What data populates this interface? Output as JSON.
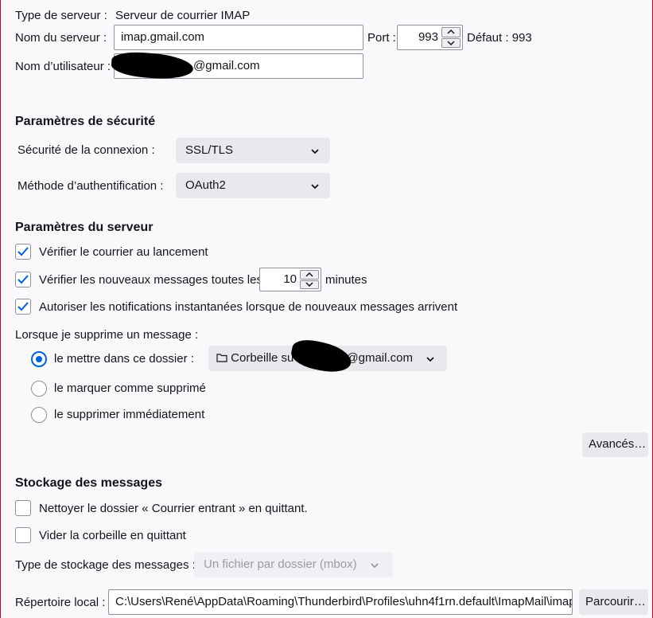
{
  "server": {
    "type_label": "Type de serveur :",
    "type_value": "Serveur de courrier IMAP",
    "name_label": "Nom du serveur :",
    "name_value": "imap.gmail.com",
    "port_label": "Port :",
    "port_value": "993",
    "default_label": "Défaut : 993",
    "user_label": "Nom d’utilisateur :",
    "user_value_suffix": "@gmail.com"
  },
  "security": {
    "heading": "Paramètres de sécurité",
    "connection_label": "Sécurité de la connexion :",
    "connection_value": "SSL/TLS",
    "auth_label": "Méthode d’authentification :",
    "auth_value": "OAuth2"
  },
  "server_settings": {
    "heading": "Paramètres du serveur",
    "check_on_start": "Vérifier le courrier au lancement",
    "check_new_prefix": "Vérifier les nouveaux messages toutes les",
    "check_interval": "10",
    "check_new_suffix": "minutes",
    "allow_notifications": "Autoriser les notifications instantanées lorsque de nouveaux messages arrivent",
    "on_delete_label": "Lorsque je supprime un message :",
    "move_to_folder": "le mettre dans ce dossier :",
    "folder_prefix": "Corbeille su",
    "folder_suffix": "@gmail.com",
    "mark_deleted": "le marquer comme supprimé",
    "delete_immediately": "le supprimer immédiatement",
    "advanced_button": "Avancés…"
  },
  "storage": {
    "heading": "Stockage des messages",
    "clean_inbox": "Nettoyer le dossier « Courrier entrant » en quittant.",
    "empty_trash": "Vider la corbeille en quittant",
    "store_type_label": "Type de stockage des messages :",
    "store_type_value": "Un fichier par dossier (mbox)",
    "local_dir_label": "Répertoire local :",
    "local_dir_value": "C:\\Users\\René\\AppData\\Roaming\\Thunderbird\\Profiles\\uhn4f1rn.default\\ImapMail\\imap.gmail.com",
    "browse_button": "Parcourir…"
  },
  "colors": {
    "accent": "#0061e0",
    "frame": "#d70022"
  },
  "icons": [
    "checkmark-icon",
    "chevron-down-icon",
    "spinner-up-icon",
    "spinner-down-icon",
    "folder-icon"
  ]
}
